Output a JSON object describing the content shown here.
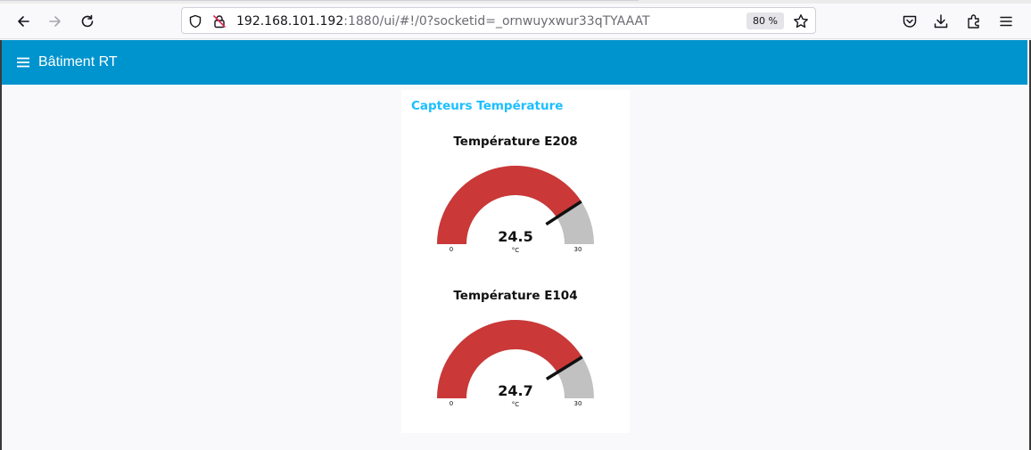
{
  "browser": {
    "url_host": "192.168.101.192",
    "url_rest": ":1880/ui/#!/0?socketid=_ornwuyxwur33qTYAAAT",
    "zoom": "80 %"
  },
  "app": {
    "title": "Bâtiment RT",
    "header_color": "#0094ce"
  },
  "group": {
    "title": "Capteurs Température"
  },
  "gauges": [
    {
      "title": "Température E208",
      "value": 24.5,
      "value_label": "24.5",
      "unit": "°C",
      "min": 0,
      "max": 30,
      "min_label": "0",
      "max_label": "30",
      "color": "#ca3838"
    },
    {
      "title": "Température E104",
      "value": 24.7,
      "value_label": "24.7",
      "unit": "°C",
      "min": 0,
      "max": 30,
      "min_label": "0",
      "max_label": "30",
      "color": "#ca3838"
    }
  ],
  "icons": {
    "back": "back-arrow-icon",
    "forward": "forward-arrow-icon",
    "reload": "reload-icon",
    "tracking": "shield-icon",
    "insecure": "insecure-lock-icon",
    "bookmark": "star-icon",
    "pocket": "pocket-icon",
    "downloads": "download-icon",
    "extensions": "extensions-icon",
    "app_menu": "hamburger-menu-icon"
  }
}
